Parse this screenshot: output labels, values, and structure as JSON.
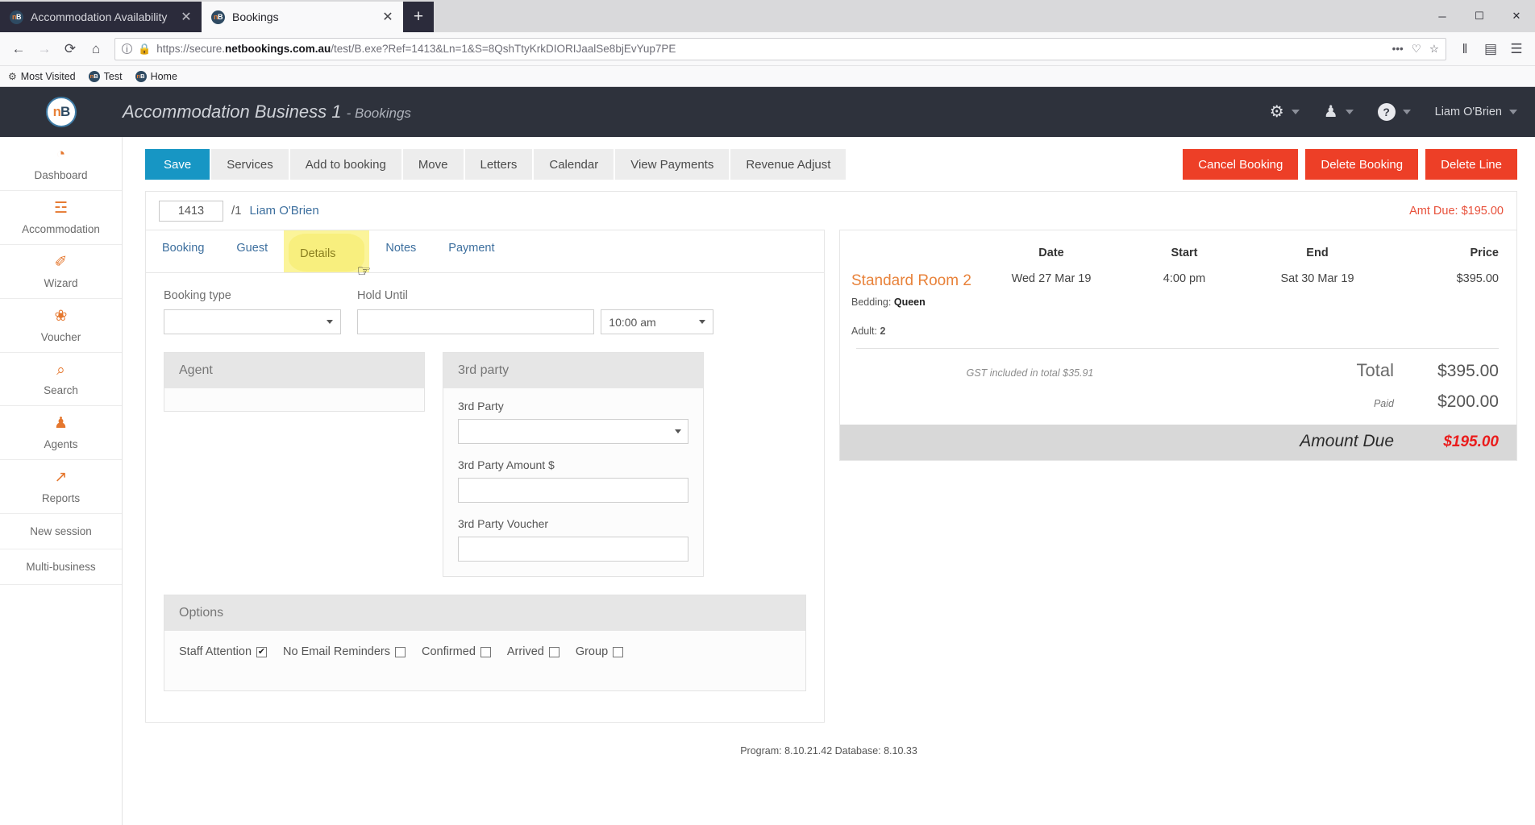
{
  "browser": {
    "tabs": [
      {
        "title": "Accommodation Availability",
        "favicon": "nb-favicon",
        "active": false
      },
      {
        "title": "Bookings",
        "favicon": "nb-favicon",
        "active": true
      }
    ],
    "new_tab_label": "+",
    "close_label": "✕",
    "url": "https://secure.netbookings.com.au/test/B.exe?Ref=1413&Ln=1&S=8QshTtyKrkDIORIJaalSe8bjEvYup7PE",
    "url_prefix": "https://secure.",
    "url_domain": "netbookings.com.au",
    "url_suffix": "/test/B.exe?Ref=1413&Ln=1&S=8QshTtyKrkDIORIJaalSe8bjEvYup7PE",
    "bookmarks": [
      {
        "label": "Most Visited",
        "icon": "gear-icon"
      },
      {
        "label": "Test",
        "icon": "nb-favicon"
      },
      {
        "label": "Home",
        "icon": "nb-favicon"
      }
    ],
    "window_controls": {
      "minimize": "─",
      "maximize": "☐",
      "close": "✕"
    },
    "nav": {
      "back": "←",
      "forward": "→",
      "reload": "⟳",
      "home": "⌂",
      "menu": "☰",
      "library": "‖",
      "sidebar": "▤",
      "page_actions": "•••",
      "pocket": "♡",
      "bookmark_star": "☆"
    }
  },
  "header": {
    "logo_text_left": "n",
    "logo_text_right": "B",
    "business_name": "Accommodation Business 1",
    "section": "- Bookings",
    "gear_icon": "⚙",
    "user_icon": "♟",
    "help_icon": "?",
    "user_name": "Liam O'Brien"
  },
  "sidebar": {
    "items": [
      {
        "label": "Dashboard",
        "icon": "◔"
      },
      {
        "label": "Accommodation",
        "icon": "☲"
      },
      {
        "label": "Wizard",
        "icon": "✐"
      },
      {
        "label": "Voucher",
        "icon": "❀"
      },
      {
        "label": "Search",
        "icon": "⌕"
      },
      {
        "label": "Agents",
        "icon": "♟"
      },
      {
        "label": "Reports",
        "icon": "↗"
      }
    ],
    "plain_items": [
      {
        "label": "New session"
      },
      {
        "label": "Multi-business"
      }
    ]
  },
  "toolbar": {
    "buttons": [
      {
        "label": "Save",
        "style": "primary"
      },
      {
        "label": "Services",
        "style": "default"
      },
      {
        "label": "Add to booking",
        "style": "default"
      },
      {
        "label": "Move",
        "style": "default"
      },
      {
        "label": "Letters",
        "style": "default"
      },
      {
        "label": "Calendar",
        "style": "default"
      },
      {
        "label": "View Payments",
        "style": "default"
      },
      {
        "label": "Revenue Adjust",
        "style": "default"
      }
    ],
    "danger_buttons": [
      {
        "label": "Cancel Booking"
      },
      {
        "label": "Delete Booking"
      },
      {
        "label": "Delete Line"
      }
    ]
  },
  "ref_row": {
    "ref_value": "1413",
    "line_suffix": "/1",
    "guest_name": "Liam O'Brien",
    "amount_due_label": "Amt Due: $195.00"
  },
  "tabs": {
    "items": [
      {
        "label": "Booking",
        "active": false
      },
      {
        "label": "Guest",
        "active": false
      },
      {
        "label": "Details",
        "active": true,
        "highlighted": true
      },
      {
        "label": "Notes",
        "active": false
      },
      {
        "label": "Payment",
        "active": false
      }
    ]
  },
  "form": {
    "booking_type_label": "Booking type",
    "booking_type_value": "",
    "hold_until_label": "Hold Until",
    "hold_until_value": "",
    "hold_until_time": "10:00 am"
  },
  "agent_card": {
    "title": "Agent"
  },
  "third_party_card": {
    "title": "3rd party",
    "fields": [
      {
        "label": "3rd Party",
        "value": "",
        "type": "select"
      },
      {
        "label": "3rd Party Amount $",
        "value": "",
        "type": "text"
      },
      {
        "label": "3rd Party Voucher",
        "value": "",
        "type": "text"
      }
    ]
  },
  "options_card": {
    "title": "Options",
    "options": [
      {
        "label": "Staff Attention",
        "checked": true
      },
      {
        "label": "No Email Reminders",
        "checked": false
      },
      {
        "label": "Confirmed",
        "checked": false
      },
      {
        "label": "Arrived",
        "checked": false
      },
      {
        "label": "Group",
        "checked": false
      }
    ],
    "check_glyph": "✔"
  },
  "summary": {
    "columns": [
      "",
      "Date",
      "Start",
      "End",
      "Price"
    ],
    "rows": [
      {
        "room": "Standard Room 2",
        "bedding_label": "Bedding:",
        "bedding_value": "Queen",
        "adult_label": "Adult:",
        "adult_value": "2",
        "date": "Wed 27 Mar 19",
        "start": "4:00 pm",
        "end": "Sat 30 Mar 19",
        "price": "$395.00"
      }
    ],
    "gst_note": "GST included in total $35.91",
    "total_label": "Total",
    "total_value": "$395.00",
    "paid_label": "Paid",
    "paid_value": "$200.00",
    "due_label": "Amount Due",
    "due_value": "$195.00"
  },
  "footer": {
    "text": "Program: 8.10.21.42 Database: 8.10.33"
  },
  "colors": {
    "accent_blue": "#1796c4",
    "danger_red": "#ed3f27",
    "brand_orange": "#e5772e",
    "header_dark": "#2e323c",
    "due_red": "#ea1c1c",
    "highlight_yellow": "#f8ef7e"
  }
}
